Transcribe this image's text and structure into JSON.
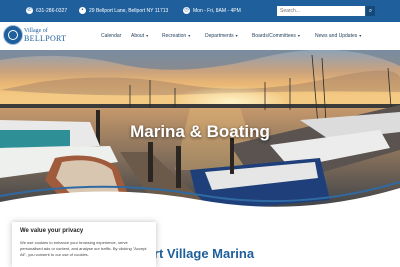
{
  "topbar": {
    "phone_icon": "phone-icon",
    "phone": "631-286-0327",
    "address_icon": "map-pin-icon",
    "address": "29 Bellport Lane, Bellport NY 11713",
    "hours_icon": "clock-icon",
    "hours": "Mon - Fri, 8AM - 4PM",
    "search_placeholder": "Search...",
    "search_icon": "search-icon"
  },
  "header": {
    "logo_line1": "Village of",
    "logo_line2": "BELLPORT",
    "nav": [
      {
        "label": "Calendar"
      },
      {
        "label": "About"
      },
      {
        "label": "Recreation"
      },
      {
        "label": "Departments"
      },
      {
        "label": "Boards/Committees"
      },
      {
        "label": "News and Updates"
      }
    ]
  },
  "hero": {
    "title": "Marina & Boating"
  },
  "main": {
    "section_title": "port Village Marina"
  },
  "cookie": {
    "title": "We value your privacy",
    "text": "We use cookies to enhance your browsing experience, serve personalised ads or content, and analyse our traffic. By clicking \"Accept All\", you consent to our use of cookies."
  },
  "colors": {
    "brand_blue": "#1e5f9c",
    "topbar": "#1e5f9c",
    "accent": "#4aa3d9"
  }
}
